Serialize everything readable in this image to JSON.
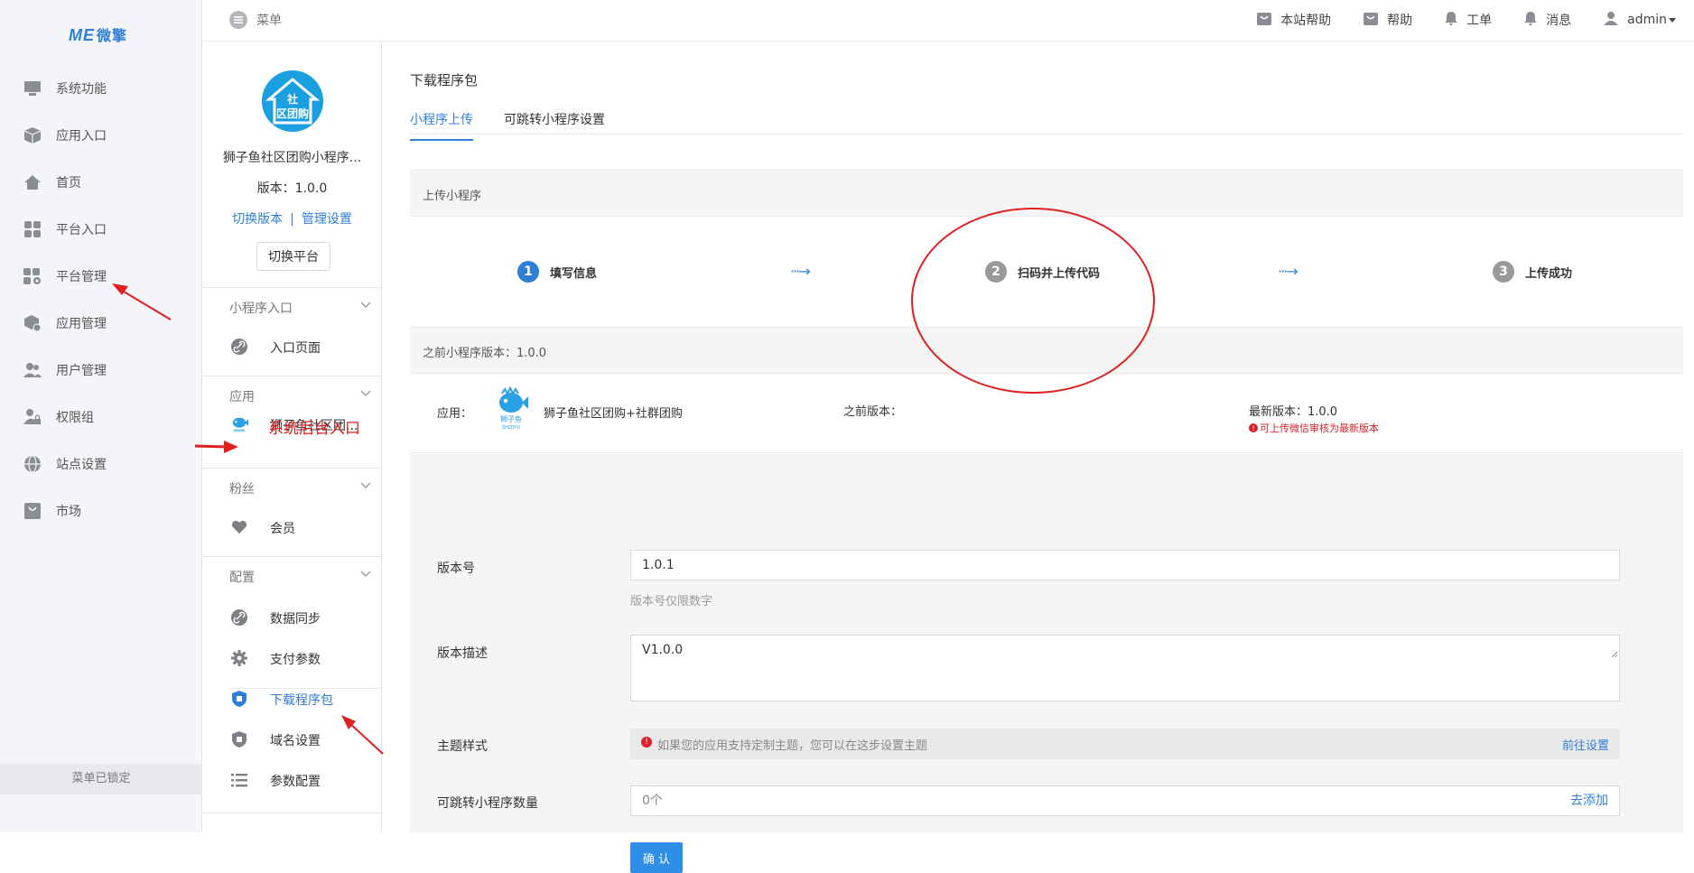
{
  "brand": {
    "logo_text": "ME",
    "logo_sub": "微擎"
  },
  "leftnav": {
    "items": [
      {
        "label": "系统功能",
        "icon": "monitor-icon"
      },
      {
        "label": "应用入口",
        "icon": "box-icon"
      },
      {
        "label": "首页",
        "icon": "home-icon"
      },
      {
        "label": "平台入口",
        "icon": "grid-icon"
      },
      {
        "label": "平台管理",
        "icon": "grid-settings-icon"
      },
      {
        "label": "应用管理",
        "icon": "box-settings-icon"
      },
      {
        "label": "用户管理",
        "icon": "users-icon"
      },
      {
        "label": "权限组",
        "icon": "user-lock-icon"
      },
      {
        "label": "站点设置",
        "icon": "globe-icon"
      },
      {
        "label": "市场",
        "icon": "shop-icon"
      }
    ],
    "locked_label": "菜单已锁定"
  },
  "topbar": {
    "menu_label": "菜单",
    "links": [
      {
        "label": "本站帮助",
        "icon": "bag-icon"
      },
      {
        "label": "帮助",
        "icon": "bag-icon"
      },
      {
        "label": "工单",
        "icon": "bell-icon"
      },
      {
        "label": "消息",
        "icon": "bell-icon"
      },
      {
        "label": "admin",
        "icon": "user-icon"
      }
    ]
  },
  "subnav": {
    "app_logo_text_1": "社",
    "app_logo_text_2": "区团购",
    "app_name": "狮子鱼社区团购小程序...",
    "version": "版本：1.0.0",
    "switch_version": "切换版本",
    "sep": "|",
    "manage_settings": "管理设置",
    "switch_platform": "切换平台",
    "sections": {
      "mini_entry": "小程序入口",
      "app": "应用",
      "fans": "粉丝",
      "config": "配置"
    },
    "entry_page": "入口页面",
    "app_item": "狮子鱼社区团...",
    "member": "会员",
    "config_items": {
      "data_sync": "数据同步",
      "pay_params": "支付参数",
      "download_pkg": "下载程序包",
      "domain_settings": "域名设置",
      "param_config": "参数配置"
    }
  },
  "main": {
    "page_title": "下载程序包",
    "tabs": [
      "小程序上传",
      "可跳转小程序设置"
    ],
    "panel_title": "上传小程序",
    "steps": [
      {
        "num": "1",
        "label": "填写信息"
      },
      {
        "num": "2",
        "label": "扫码并上传代码"
      },
      {
        "num": "3",
        "label": "上传成功"
      }
    ],
    "prev_version_bar": "之前小程序版本：1.0.0",
    "app_row": {
      "app_label": "应用：",
      "app_name": "狮子鱼社区团购+社群团购",
      "app_logo_caption": "狮子鱼",
      "app_logo_caption_en": "SHIZIYU",
      "prev_version_label": "之前版本：",
      "latest_version": "最新版本：1.0.0",
      "latest_note": "可上传微信审核为最新版本"
    },
    "form": {
      "version_label": "版本号",
      "version_value": "1.0.1",
      "version_help": "版本号仅限数字",
      "desc_label": "版本描述",
      "desc_value": "V1.0.0",
      "theme_label": "主题样式",
      "theme_notice": "如果您的应用支持定制主题，您可以在这步设置主题",
      "theme_link": "前往设置",
      "jump_label": "可跳转小程序数量",
      "jump_value": "0个",
      "jump_link": "去添加",
      "confirm": "确 认"
    }
  },
  "annotation": {
    "text": "系统后台入口"
  },
  "colors": {
    "accent": "#2f7fd6",
    "annotation": "#e02020"
  }
}
